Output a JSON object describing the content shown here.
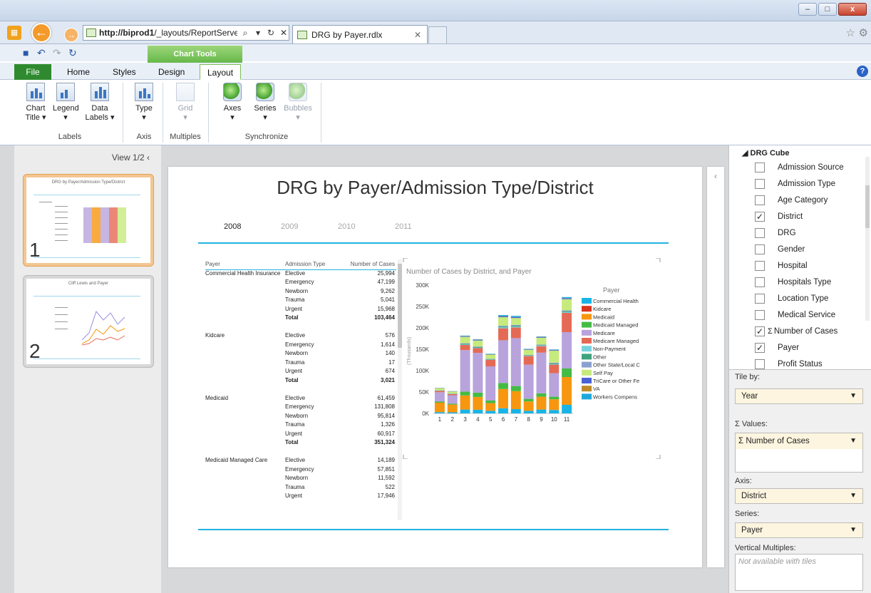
{
  "browser": {
    "url_host": "http://biprod1",
    "url_rest": "/_layouts/ReportServer/",
    "tab_title": "DRG by Payer.rdlx"
  },
  "ribbon": {
    "context_group": "Chart Tools",
    "tabs": [
      "File",
      "Home",
      "Styles",
      "Design",
      "Layout"
    ],
    "active_tab": "Layout",
    "buttons": {
      "chart_title": "Chart Title",
      "legend": "Legend",
      "data_labels": "Data Labels",
      "type": "Type",
      "grid": "Grid",
      "axes": "Axes",
      "series": "Series",
      "bubbles": "Bubbles"
    },
    "groups": {
      "labels": "Labels",
      "axis": "Axis",
      "multiples": "Multiples",
      "synchronize": "Synchronize"
    }
  },
  "left_pane": {
    "view_label": "View 1/2",
    "thumbnails": [
      {
        "number": "1",
        "title": "DRG by Payer/Admission Type/District"
      },
      {
        "number": "2",
        "title": "Cliff Lewis and Payer"
      }
    ]
  },
  "report": {
    "title": "DRG by Payer/Admission Type/District",
    "years": [
      "2008",
      "2009",
      "2010",
      "2011"
    ],
    "selected_year": "2008",
    "table": {
      "headers": [
        "Payer",
        "Admission Type",
        "Number of Cases"
      ],
      "rows": [
        [
          "Commercial Health Insurance",
          "Elective",
          "25,994",
          false
        ],
        [
          "",
          "Emergency",
          "47,199",
          false
        ],
        [
          "",
          "Newborn",
          "9,262",
          false
        ],
        [
          "",
          "Trauma",
          "5,041",
          false
        ],
        [
          "",
          "Urgent",
          "15,968",
          false
        ],
        [
          "",
          "Total",
          "103,464",
          true
        ],
        [
          "",
          "",
          "",
          false
        ],
        [
          "Kidcare",
          "Elective",
          "576",
          false
        ],
        [
          "",
          "Emergency",
          "1,614",
          false
        ],
        [
          "",
          "Newborn",
          "140",
          false
        ],
        [
          "",
          "Trauma",
          "17",
          false
        ],
        [
          "",
          "Urgent",
          "674",
          false
        ],
        [
          "",
          "Total",
          "3,021",
          true
        ],
        [
          "",
          "",
          "",
          false
        ],
        [
          "Medicaid",
          "Elective",
          "61,459",
          false
        ],
        [
          "",
          "Emergency",
          "131,808",
          false
        ],
        [
          "",
          "Newborn",
          "95,814",
          false
        ],
        [
          "",
          "Trauma",
          "1,326",
          false
        ],
        [
          "",
          "Urgent",
          "60,917",
          false
        ],
        [
          "",
          "Total",
          "351,324",
          true
        ],
        [
          "",
          "",
          "",
          false
        ],
        [
          "Medicaid Managed Care",
          "Elective",
          "14,189",
          false
        ],
        [
          "",
          "Emergency",
          "57,851",
          false
        ],
        [
          "",
          "Newborn",
          "11,592",
          false
        ],
        [
          "",
          "Trauma",
          "522",
          false
        ],
        [
          "",
          "Urgent",
          "17,946",
          false
        ]
      ]
    }
  },
  "chart_data": {
    "type": "bar",
    "stacked": true,
    "title": "Number of Cases by District, and Payer",
    "ylabel": "(Thousands)",
    "ylim": [
      0,
      300000
    ],
    "yticks": [
      0,
      50000,
      100000,
      150000,
      200000,
      250000,
      300000
    ],
    "ytick_labels": [
      "0K",
      "50K",
      "100K",
      "150K",
      "200K",
      "250K",
      "300K"
    ],
    "categories": [
      "1",
      "2",
      "3",
      "4",
      "5",
      "6",
      "7",
      "8",
      "9",
      "10",
      "11"
    ],
    "legend_title": "Payer",
    "legend_position": "right",
    "series": [
      {
        "name": "Commercial Health",
        "color": "#19b4e6",
        "values": [
          3000,
          2500,
          9000,
          8500,
          6000,
          12000,
          10000,
          6000,
          9000,
          8000,
          20000
        ]
      },
      {
        "name": "Kidcare",
        "color": "#d9341c",
        "values": [
          0,
          0,
          0,
          0,
          0,
          0,
          0,
          0,
          0,
          0,
          0
        ]
      },
      {
        "name": "Medicaid",
        "color": "#f7960f",
        "values": [
          22000,
          18000,
          33000,
          30000,
          18000,
          45000,
          42000,
          22000,
          30000,
          25000,
          65000
        ]
      },
      {
        "name": "Medicaid Managed",
        "color": "#44bb44",
        "values": [
          2500,
          2000,
          9000,
          10000,
          6000,
          14000,
          12000,
          6000,
          8000,
          6000,
          20000
        ]
      },
      {
        "name": "Medicare",
        "color": "#b8a3dc",
        "values": [
          22000,
          20000,
          97000,
          93000,
          80000,
          100000,
          112000,
          80000,
          95000,
          55000,
          85000
        ]
      },
      {
        "name": "Medicare Managed",
        "color": "#e56a56",
        "values": [
          3000,
          2500,
          12000,
          11000,
          15000,
          28000,
          25000,
          20000,
          15000,
          20000,
          45000
        ]
      },
      {
        "name": "Non-Payment",
        "color": "#76d3de",
        "values": [
          500,
          500,
          1000,
          1000,
          500,
          2000,
          2000,
          1000,
          1000,
          1000,
          2000
        ]
      },
      {
        "name": "Other",
        "color": "#3da37c",
        "values": [
          500,
          500,
          1500,
          1500,
          1000,
          2000,
          2000,
          1000,
          1500,
          1500,
          2000
        ]
      },
      {
        "name": "Other State/Local C",
        "color": "#8aa1d1",
        "values": [
          500,
          500,
          1500,
          1500,
          1000,
          2000,
          2000,
          1000,
          1500,
          2000,
          2000
        ]
      },
      {
        "name": "Self Pay",
        "color": "#c7ea7c",
        "values": [
          5000,
          4500,
          15000,
          14000,
          10000,
          20000,
          16000,
          12000,
          16000,
          28000,
          26000
        ]
      },
      {
        "name": "TriCare or Other Fe",
        "color": "#4a62d4",
        "values": [
          500,
          500,
          1500,
          1500,
          1000,
          2000,
          2000,
          1000,
          1500,
          1500,
          2000
        ]
      },
      {
        "name": "VA",
        "color": "#c08a26",
        "values": [
          200,
          200,
          500,
          500,
          300,
          500,
          500,
          300,
          500,
          500,
          500
        ]
      },
      {
        "name": "Workers Compens",
        "color": "#1ea9dd",
        "values": [
          300,
          300,
          1000,
          1000,
          700,
          2500,
          2500,
          800,
          1000,
          1000,
          2500
        ]
      }
    ]
  },
  "fields": {
    "cube": "DRG Cube",
    "items": [
      {
        "label": "Admission Source",
        "checked": false,
        "sigma": false
      },
      {
        "label": "Admission Type",
        "checked": false,
        "sigma": false
      },
      {
        "label": "Age Category",
        "checked": false,
        "sigma": false
      },
      {
        "label": "District",
        "checked": true,
        "sigma": false
      },
      {
        "label": "DRG",
        "checked": false,
        "sigma": false
      },
      {
        "label": "Gender",
        "checked": false,
        "sigma": false
      },
      {
        "label": "Hospital",
        "checked": false,
        "sigma": false
      },
      {
        "label": "Hospitals Type",
        "checked": false,
        "sigma": false
      },
      {
        "label": "Location Type",
        "checked": false,
        "sigma": false
      },
      {
        "label": "Medical Service",
        "checked": false,
        "sigma": false
      },
      {
        "label": "Number of Cases",
        "checked": true,
        "sigma": true
      },
      {
        "label": "Payer",
        "checked": true,
        "sigma": false
      },
      {
        "label": "Profit Status",
        "checked": false,
        "sigma": false
      }
    ]
  },
  "panel": {
    "tile_by_label": "Tile by:",
    "tile_by_value": "Year",
    "values_label": "Values:",
    "values_item": "Number of Cases",
    "axis_label": "Axis:",
    "axis_value": "District",
    "series_label": "Series:",
    "series_value": "Payer",
    "vm_label": "Vertical Multiples:",
    "vm_placeholder": "Not available with tiles"
  }
}
